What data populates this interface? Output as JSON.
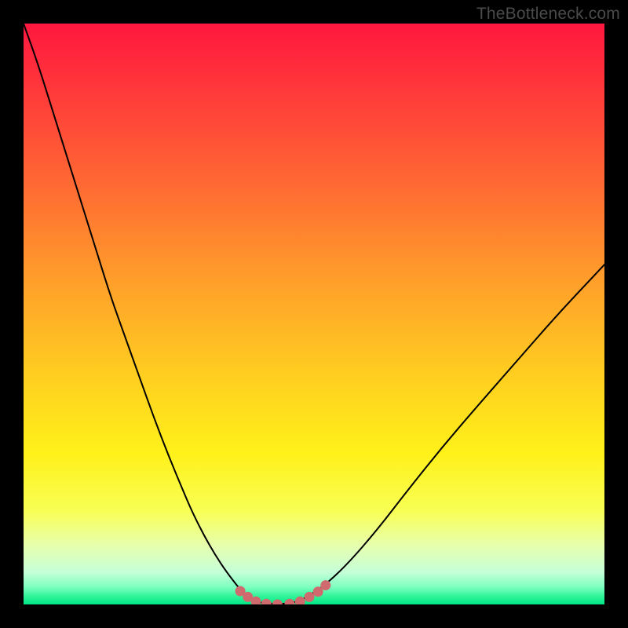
{
  "watermark": "TheBottleneck.com",
  "chart_data": {
    "type": "line",
    "title": "",
    "xlabel": "",
    "ylabel": "",
    "xlim": [
      0,
      100
    ],
    "ylim": [
      0,
      100
    ],
    "grid": false,
    "background_gradient_description": "vertical rainbow gradient from red (top) through orange, yellow to green (bottom)",
    "background_gradient_stops": [
      {
        "offset": 0.0,
        "color": "#ff173f"
      },
      {
        "offset": 0.12,
        "color": "#ff3a3a"
      },
      {
        "offset": 0.28,
        "color": "#ff6a33"
      },
      {
        "offset": 0.45,
        "color": "#ffa12a"
      },
      {
        "offset": 0.62,
        "color": "#ffd21f"
      },
      {
        "offset": 0.74,
        "color": "#fff11a"
      },
      {
        "offset": 0.84,
        "color": "#f8ff55"
      },
      {
        "offset": 0.9,
        "color": "#e6ffb0"
      },
      {
        "offset": 0.945,
        "color": "#c4ffd8"
      },
      {
        "offset": 0.97,
        "color": "#7dffc0"
      },
      {
        "offset": 0.985,
        "color": "#35f59b"
      },
      {
        "offset": 1.0,
        "color": "#00e585"
      }
    ],
    "series": [
      {
        "name": "bottleneck-curve",
        "stroke": "#000000",
        "stroke_width": 2,
        "x": [
          0.0,
          2.5,
          5.0,
          7.5,
          10.0,
          12.5,
          15.0,
          17.5,
          20.0,
          22.5,
          25.0,
          27.5,
          29.0,
          31.0,
          33.0,
          35.0,
          37.5,
          38.5,
          40.0,
          44.0,
          47.0,
          49.0,
          52.0,
          56.0,
          61.0,
          66.0,
          72.0,
          78.0,
          85.0,
          92.0,
          100.0
        ],
        "y": [
          100.0,
          93.0,
          85.0,
          77.0,
          69.0,
          61.0,
          53.0,
          46.0,
          39.0,
          32.0,
          25.5,
          19.5,
          16.0,
          12.0,
          8.5,
          5.5,
          2.3,
          1.3,
          0.4,
          0.0,
          0.4,
          1.4,
          3.4,
          7.2,
          13.0,
          19.5,
          27.0,
          34.0,
          42.0,
          50.0,
          58.5
        ]
      },
      {
        "name": "valley-highlight-dots",
        "type": "scatter",
        "stroke": "#cf6b6e",
        "fill": "#cf6b6e",
        "marker_radius": 6.5,
        "x": [
          37.3,
          38.6,
          40.0,
          41.8,
          43.7,
          45.8,
          47.6,
          49.2,
          50.7,
          52.0
        ],
        "y": [
          2.3,
          1.3,
          0.5,
          0.1,
          0.0,
          0.1,
          0.5,
          1.3,
          2.2,
          3.3
        ]
      }
    ]
  }
}
